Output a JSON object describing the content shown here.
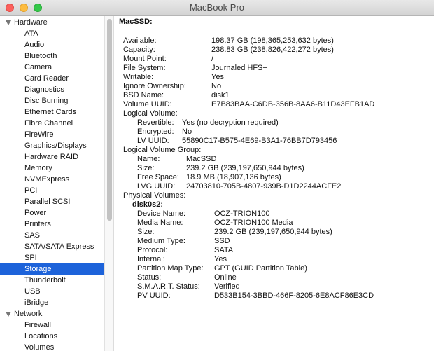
{
  "window": {
    "title": "MacBook Pro"
  },
  "sidebar": {
    "groups": [
      {
        "label": "Hardware",
        "items": [
          "ATA",
          "Audio",
          "Bluetooth",
          "Camera",
          "Card Reader",
          "Diagnostics",
          "Disc Burning",
          "Ethernet Cards",
          "Fibre Channel",
          "FireWire",
          "Graphics/Displays",
          "Hardware RAID",
          "Memory",
          "NVMExpress",
          "PCI",
          "Parallel SCSI",
          "Power",
          "Printers",
          "SAS",
          "SATA/SATA Express",
          "SPI",
          "Storage",
          "Thunderbolt",
          "USB",
          "iBridge"
        ]
      },
      {
        "label": "Network",
        "items": [
          "Firewall",
          "Locations",
          "Volumes"
        ]
      }
    ],
    "selected": "Storage"
  },
  "detail": {
    "volume_name": "MacSSD:",
    "available": {
      "label": "Available:",
      "value": "198.37 GB (198,365,253,632 bytes)"
    },
    "capacity": {
      "label": "Capacity:",
      "value": "238.83 GB (238,826,422,272 bytes)"
    },
    "mount_point": {
      "label": "Mount Point:",
      "value": "/"
    },
    "file_system": {
      "label": "File System:",
      "value": "Journaled HFS+"
    },
    "writable": {
      "label": "Writable:",
      "value": "Yes"
    },
    "ignore_ownership": {
      "label": "Ignore Ownership:",
      "value": "No"
    },
    "bsd_name": {
      "label": "BSD Name:",
      "value": "disk1"
    },
    "volume_uuid": {
      "label": "Volume UUID:",
      "value": "E7B83BAA-C6DB-356B-8AA6-B11D43EFB1AD"
    },
    "logical_volume": {
      "label": "Logical Volume:",
      "revertible": {
        "label": "Revertible:",
        "value": "Yes (no decryption required)"
      },
      "encrypted": {
        "label": "Encrypted:",
        "value": "No"
      },
      "lv_uuid": {
        "label": "LV UUID:",
        "value": "55890C17-B575-4E69-B3A1-76BB7D793456"
      }
    },
    "logical_volume_group": {
      "label": "Logical Volume Group:",
      "name": {
        "label": "Name:",
        "value": "MacSSD"
      },
      "size": {
        "label": "Size:",
        "value": "239.2 GB (239,197,650,944 bytes)"
      },
      "free_space": {
        "label": "Free Space:",
        "value": "18.9 MB (18,907,136 bytes)"
      },
      "lvg_uuid": {
        "label": "LVG UUID:",
        "value": "24703810-705B-4807-939B-D1D2244ACFE2"
      }
    },
    "physical_volumes": {
      "label": "Physical Volumes:",
      "disk_name": "disk0s2:",
      "device_name": {
        "label": "Device Name:",
        "value": "OCZ-TRION100"
      },
      "media_name": {
        "label": "Media Name:",
        "value": "OCZ-TRION100 Media"
      },
      "size": {
        "label": "Size:",
        "value": "239.2 GB (239,197,650,944 bytes)"
      },
      "medium_type": {
        "label": "Medium Type:",
        "value": "SSD"
      },
      "protocol": {
        "label": "Protocol:",
        "value": "SATA"
      },
      "internal": {
        "label": "Internal:",
        "value": "Yes"
      },
      "partition_map_type": {
        "label": "Partition Map Type:",
        "value": "GPT (GUID Partition Table)"
      },
      "status": {
        "label": "Status:",
        "value": "Online"
      },
      "smart_status": {
        "label": "S.M.A.R.T. Status:",
        "value": "Verified"
      },
      "pv_uuid": {
        "label": "PV UUID:",
        "value": "D533B154-3BBD-466F-8205-6E8ACF86E3CD"
      }
    }
  },
  "colors": {
    "selection": "#1d63da",
    "close": "#fc605c",
    "minimize": "#fdbc40",
    "maximize": "#34c84a"
  }
}
